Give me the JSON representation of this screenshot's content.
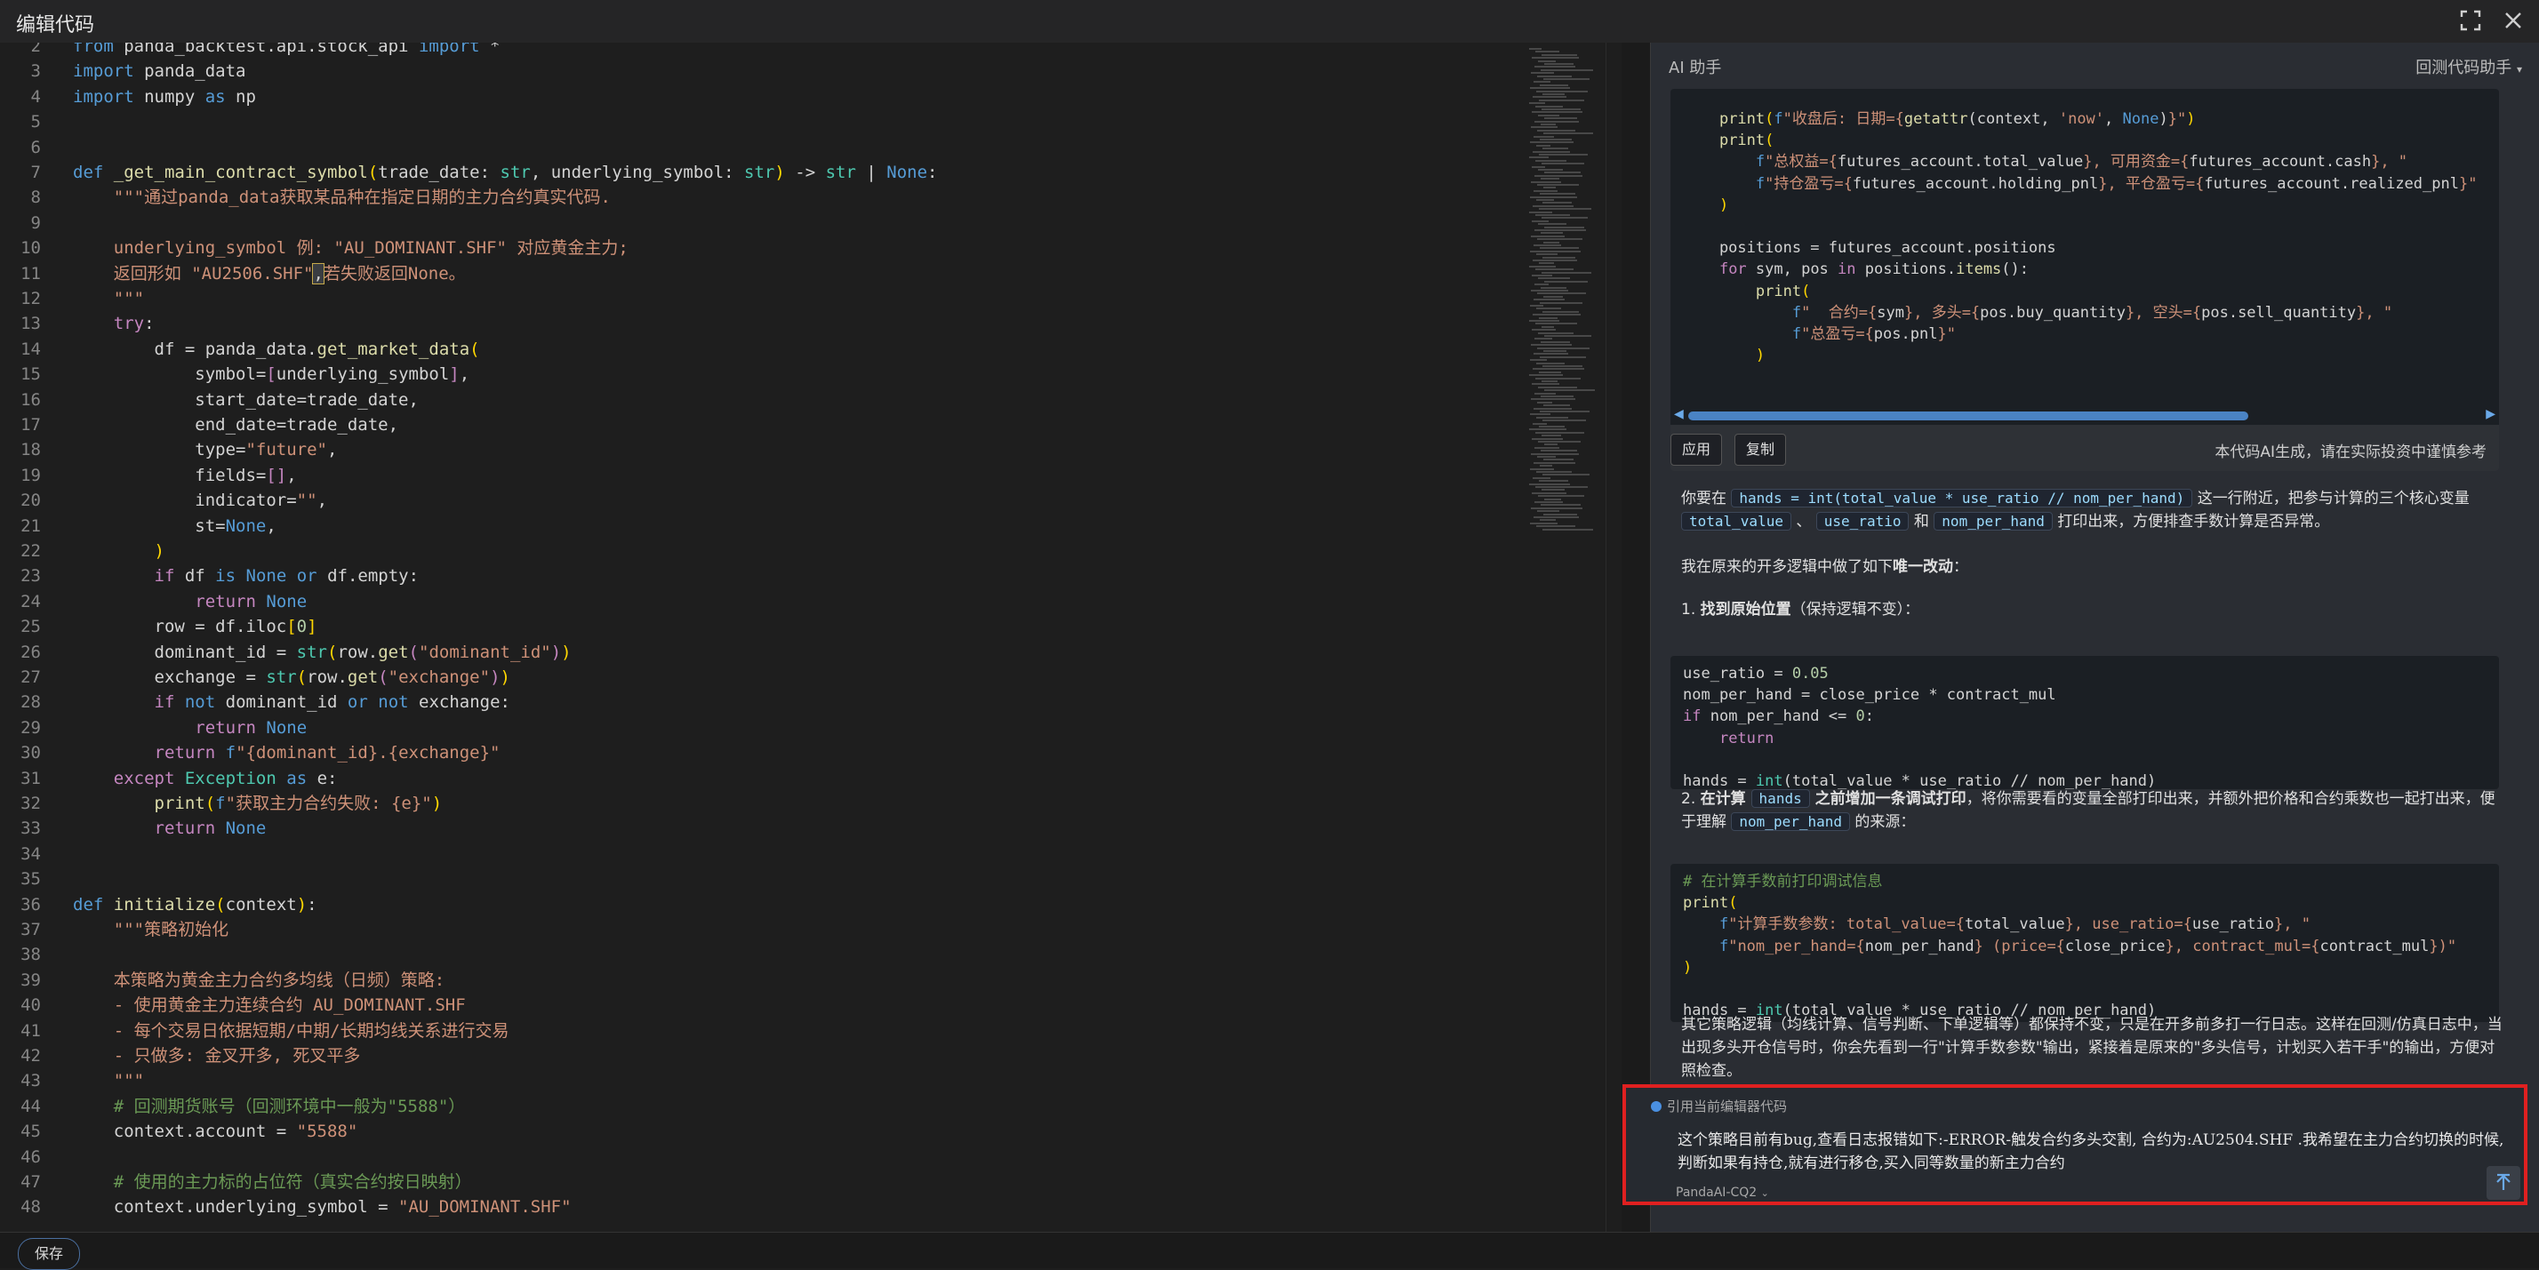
{
  "window": {
    "title": "编辑代码",
    "bottom_button": "保存"
  },
  "editor": {
    "lines": [
      {
        "n": "2",
        "t": [
          [
            "kw",
            "from"
          ],
          [
            "id",
            " panda_backtest.api.stock_api "
          ],
          [
            "kw",
            "import"
          ],
          [
            "id",
            " *"
          ]
        ]
      },
      {
        "n": "3",
        "t": [
          [
            "kw",
            "import"
          ],
          [
            "id",
            " panda_data"
          ]
        ]
      },
      {
        "n": "4",
        "t": [
          [
            "kw",
            "import"
          ],
          [
            "id",
            " numpy "
          ],
          [
            "kw",
            "as"
          ],
          [
            "id",
            " np"
          ]
        ]
      },
      {
        "n": "5",
        "t": []
      },
      {
        "n": "6",
        "t": []
      },
      {
        "n": "7",
        "t": [
          [
            "kw",
            "def"
          ],
          [
            "id",
            " "
          ],
          [
            "fn",
            "_get_main_contract_symbol"
          ],
          [
            "pa",
            "("
          ],
          [
            "id",
            "trade_date: "
          ],
          [
            "bu",
            "str"
          ],
          [
            "id",
            ", underlying_symbol: "
          ],
          [
            "bu",
            "str"
          ],
          [
            "pa",
            ")"
          ],
          [
            "id",
            " -> "
          ],
          [
            "bu",
            "str"
          ],
          [
            "id",
            " | "
          ],
          [
            "kw",
            "None"
          ],
          [
            "id",
            ":"
          ]
        ]
      },
      {
        "n": "8",
        "t": [
          [
            "str",
            "    \"\"\"通过panda_data获取某品种在指定日期的主力合约真实代码."
          ]
        ]
      },
      {
        "n": "9",
        "t": []
      },
      {
        "n": "10",
        "t": [
          [
            "str",
            "    underlying_symbol 例: \"AU_DOMINANT.SHF\" 对应黄金主力;"
          ]
        ]
      },
      {
        "n": "11",
        "t": [
          [
            "str",
            "    返回形如 \"AU2506.SHF\""
          ],
          [
            "hl",
            ","
          ],
          [
            "str",
            "若失败返回None。"
          ]
        ]
      },
      {
        "n": "12",
        "t": [
          [
            "str",
            "    \"\"\""
          ]
        ]
      },
      {
        "n": "13",
        "t": [
          [
            "id",
            "    "
          ],
          [
            "ctl",
            "try"
          ],
          [
            "id",
            ":"
          ]
        ]
      },
      {
        "n": "14",
        "t": [
          [
            "id",
            "        df = panda_data."
          ],
          [
            "fn",
            "get_market_data"
          ],
          [
            "pa",
            "("
          ]
        ]
      },
      {
        "n": "15",
        "t": [
          [
            "id",
            "            symbol="
          ],
          [
            "ctl",
            "["
          ],
          [
            "id",
            "underlying_symbol"
          ],
          [
            "ctl",
            "]"
          ],
          [
            "id",
            ","
          ]
        ]
      },
      {
        "n": "16",
        "t": [
          [
            "id",
            "            start_date=trade_date,"
          ]
        ]
      },
      {
        "n": "17",
        "t": [
          [
            "id",
            "            end_date=trade_date,"
          ]
        ]
      },
      {
        "n": "18",
        "t": [
          [
            "id",
            "            type="
          ],
          [
            "str",
            "\"future\""
          ],
          [
            "id",
            ","
          ]
        ]
      },
      {
        "n": "19",
        "t": [
          [
            "id",
            "            fields="
          ],
          [
            "ctl",
            "[]"
          ],
          [
            "id",
            ","
          ]
        ]
      },
      {
        "n": "20",
        "t": [
          [
            "id",
            "            indicator="
          ],
          [
            "str",
            "\"\""
          ],
          [
            "id",
            ","
          ]
        ]
      },
      {
        "n": "21",
        "t": [
          [
            "id",
            "            st="
          ],
          [
            "kw",
            "None"
          ],
          [
            "id",
            ","
          ]
        ]
      },
      {
        "n": "22",
        "t": [
          [
            "pa",
            "        )"
          ]
        ]
      },
      {
        "n": "23",
        "t": [
          [
            "id",
            "        "
          ],
          [
            "ctl",
            "if"
          ],
          [
            "id",
            " df "
          ],
          [
            "kw",
            "is"
          ],
          [
            "id",
            " "
          ],
          [
            "kw",
            "None"
          ],
          [
            "id",
            " "
          ],
          [
            "kw",
            "or"
          ],
          [
            "id",
            " df.empty:"
          ]
        ]
      },
      {
        "n": "24",
        "t": [
          [
            "id",
            "            "
          ],
          [
            "ctl",
            "return"
          ],
          [
            "id",
            " "
          ],
          [
            "kw",
            "None"
          ]
        ]
      },
      {
        "n": "25",
        "t": [
          [
            "id",
            "        row = df.iloc"
          ],
          [
            "pa",
            "["
          ],
          [
            "num",
            "0"
          ],
          [
            "pa",
            "]"
          ]
        ]
      },
      {
        "n": "26",
        "t": [
          [
            "id",
            "        dominant_id = "
          ],
          [
            "bu",
            "str"
          ],
          [
            "pa",
            "("
          ],
          [
            "id",
            "row."
          ],
          [
            "fn",
            "get"
          ],
          [
            "ctl",
            "("
          ],
          [
            "str",
            "\"dominant_id\""
          ],
          [
            "ctl",
            ")"
          ],
          [
            "pa",
            ")"
          ]
        ]
      },
      {
        "n": "27",
        "t": [
          [
            "id",
            "        exchange = "
          ],
          [
            "bu",
            "str"
          ],
          [
            "pa",
            "("
          ],
          [
            "id",
            "row."
          ],
          [
            "fn",
            "get"
          ],
          [
            "ctl",
            "("
          ],
          [
            "str",
            "\"exchange\""
          ],
          [
            "ctl",
            ")"
          ],
          [
            "pa",
            ")"
          ]
        ]
      },
      {
        "n": "28",
        "t": [
          [
            "id",
            "        "
          ],
          [
            "ctl",
            "if"
          ],
          [
            "id",
            " "
          ],
          [
            "kw",
            "not"
          ],
          [
            "id",
            " dominant_id "
          ],
          [
            "kw",
            "or"
          ],
          [
            "id",
            " "
          ],
          [
            "kw",
            "not"
          ],
          [
            "id",
            " exchange:"
          ]
        ]
      },
      {
        "n": "29",
        "t": [
          [
            "id",
            "            "
          ],
          [
            "ctl",
            "return"
          ],
          [
            "id",
            " "
          ],
          [
            "kw",
            "None"
          ]
        ]
      },
      {
        "n": "30",
        "t": [
          [
            "id",
            "        "
          ],
          [
            "ctl",
            "return"
          ],
          [
            "id",
            " "
          ],
          [
            "kw",
            "f"
          ],
          [
            "str",
            "\"{dominant_id}.{exchange}\""
          ]
        ]
      },
      {
        "n": "31",
        "t": [
          [
            "id",
            "    "
          ],
          [
            "ctl",
            "except"
          ],
          [
            "id",
            " "
          ],
          [
            "bu",
            "Exception"
          ],
          [
            "id",
            " "
          ],
          [
            "kw",
            "as"
          ],
          [
            "id",
            " e:"
          ]
        ]
      },
      {
        "n": "32",
        "t": [
          [
            "id",
            "        "
          ],
          [
            "fn",
            "print"
          ],
          [
            "pa",
            "("
          ],
          [
            "kw",
            "f"
          ],
          [
            "str",
            "\"获取主力合约失败: {e}\""
          ],
          [
            "pa",
            ")"
          ]
        ]
      },
      {
        "n": "33",
        "t": [
          [
            "id",
            "        "
          ],
          [
            "ctl",
            "return"
          ],
          [
            "id",
            " "
          ],
          [
            "kw",
            "None"
          ]
        ]
      },
      {
        "n": "34",
        "t": []
      },
      {
        "n": "35",
        "t": []
      },
      {
        "n": "36",
        "t": [
          [
            "kw",
            "def"
          ],
          [
            "id",
            " "
          ],
          [
            "fn",
            "initialize"
          ],
          [
            "pa",
            "("
          ],
          [
            "id",
            "context"
          ],
          [
            "pa",
            ")"
          ],
          [
            "id",
            ":"
          ]
        ]
      },
      {
        "n": "37",
        "t": [
          [
            "str",
            "    \"\"\"策略初始化"
          ]
        ]
      },
      {
        "n": "38",
        "t": []
      },
      {
        "n": "39",
        "t": [
          [
            "str",
            "    本策略为黄金主力合约多均线（日频）策略:"
          ]
        ]
      },
      {
        "n": "40",
        "t": [
          [
            "str",
            "    - 使用黄金主力连续合约 AU_DOMINANT.SHF"
          ]
        ]
      },
      {
        "n": "41",
        "t": [
          [
            "str",
            "    - 每个交易日依据短期/中期/长期均线关系进行交易"
          ]
        ]
      },
      {
        "n": "42",
        "t": [
          [
            "str",
            "    - 只做多: 金叉开多, 死叉平多"
          ]
        ]
      },
      {
        "n": "43",
        "t": [
          [
            "str",
            "    \"\"\""
          ]
        ]
      },
      {
        "n": "44",
        "t": [
          [
            "cm",
            "    # 回测期货账号（回测环境中一般为\"5588\"）"
          ]
        ]
      },
      {
        "n": "45",
        "t": [
          [
            "id",
            "    context.account = "
          ],
          [
            "str",
            "\"5588\""
          ]
        ]
      },
      {
        "n": "46",
        "t": []
      },
      {
        "n": "47",
        "t": [
          [
            "cm",
            "    # 使用的主力标的占位符（真实合约按日映射）"
          ]
        ]
      },
      {
        "n": "48",
        "t": [
          [
            "id",
            "    context.underlying_symbol = "
          ],
          [
            "str",
            "\"AU_DOMINANT.SHF\""
          ]
        ]
      }
    ]
  },
  "assistant": {
    "title": "AI 助手",
    "mode": "回测代码助手",
    "code1": [
      [
        [
          "id",
          "    "
        ],
        [
          "fn",
          "print"
        ],
        [
          "pa",
          "("
        ],
        [
          "kw",
          "f"
        ],
        [
          "str",
          "\"收盘后: 日期={"
        ],
        [
          "fn",
          "getattr"
        ],
        [
          "id",
          "(context, "
        ],
        [
          "str",
          "'now'"
        ],
        [
          "id",
          ", "
        ],
        [
          "kw",
          "None"
        ],
        [
          "id",
          ")"
        ],
        [
          "str",
          "}\""
        ],
        [
          "pa",
          ")"
        ]
      ],
      [
        [
          "id",
          "    "
        ],
        [
          "fn",
          "print"
        ],
        [
          "pa",
          "("
        ]
      ],
      [
        [
          "id",
          "        "
        ],
        [
          "kw",
          "f"
        ],
        [
          "str",
          "\"总权益={"
        ],
        [
          "id",
          "futures_account.total_value"
        ],
        [
          "str",
          "}, 可用资金={"
        ],
        [
          "id",
          "futures_account.cash"
        ],
        [
          "str",
          "}, \""
        ]
      ],
      [
        [
          "id",
          "        "
        ],
        [
          "kw",
          "f"
        ],
        [
          "str",
          "\"持仓盈亏={"
        ],
        [
          "id",
          "futures_account.holding_pnl"
        ],
        [
          "str",
          "}, 平仓盈亏={"
        ],
        [
          "id",
          "futures_account.realized_pnl"
        ],
        [
          "str",
          "}\""
        ]
      ],
      [
        [
          "pa",
          "    )"
        ]
      ],
      [],
      [
        [
          "id",
          "    positions = futures_account.positions"
        ]
      ],
      [
        [
          "id",
          "    "
        ],
        [
          "ctl",
          "for"
        ],
        [
          "id",
          " sym, pos "
        ],
        [
          "ctl",
          "in"
        ],
        [
          "id",
          " positions."
        ],
        [
          "fn",
          "items"
        ],
        [
          "id",
          "():"
        ]
      ],
      [
        [
          "id",
          "        "
        ],
        [
          "fn",
          "print"
        ],
        [
          "pa",
          "("
        ]
      ],
      [
        [
          "id",
          "            "
        ],
        [
          "kw",
          "f"
        ],
        [
          "str",
          "\"  合约={"
        ],
        [
          "id",
          "sym"
        ],
        [
          "str",
          "}, 多头={"
        ],
        [
          "id",
          "pos.buy_quantity"
        ],
        [
          "str",
          "}, 空头={"
        ],
        [
          "id",
          "pos.sell_quantity"
        ],
        [
          "str",
          "}, \""
        ]
      ],
      [
        [
          "id",
          "            "
        ],
        [
          "kw",
          "f"
        ],
        [
          "str",
          "\"总盈亏={"
        ],
        [
          "id",
          "pos.pnl"
        ],
        [
          "str",
          "}\""
        ]
      ],
      [
        [
          "pa",
          "        )"
        ]
      ]
    ],
    "btn_apply": "应用",
    "btn_copy": "复制",
    "disclaimer": "本代码AI生成，请在实际投资中谨慎参考",
    "p1a": "你要在 ",
    "p1_code": "hands = int(total_value * use_ratio // nom_per_hand)",
    "p1b": " 这一行附近，把参与计算的三个核心变量",
    "p1_v1": "total_value",
    "p1_sep": " 、",
    "p1_v2": "use_ratio",
    "p1_and": " 和 ",
    "p1_v3": "nom_per_hand",
    "p1c": " 打印出来，方便排查手数计算是否异常。",
    "p2a": "我在原来的开多逻辑中做了如下",
    "p2b": "唯一改动",
    "p2c": "：",
    "s1num": "1. ",
    "s1a": "找到原始位置",
    "s1b": "（保持逻辑不变）：",
    "code2": [
      [
        [
          "id",
          "use_ratio = "
        ],
        [
          "num",
          "0.05"
        ]
      ],
      [
        [
          "id",
          "nom_per_hand = close_price * contract_mul"
        ]
      ],
      [
        [
          "ctl",
          "if"
        ],
        [
          "id",
          " nom_per_hand <= "
        ],
        [
          "num",
          "0"
        ],
        [
          "id",
          ":"
        ]
      ],
      [
        [
          "id",
          "    "
        ],
        [
          "ctl",
          "return"
        ]
      ],
      [],
      [
        [
          "id",
          "hands = "
        ],
        [
          "bu",
          "int"
        ],
        [
          "id",
          "(total_value * use_ratio // nom_per_hand)"
        ]
      ]
    ],
    "s2num": "2. ",
    "s2a": "在计算 ",
    "s2code": "hands",
    "s2b": " 之前增加一条调试打印",
    "s2c": "，将你需要看的变量全部打印出来，并额外把价格和合约乘数也一起打出来，便于理解 ",
    "s2code2": "nom_per_hand",
    "s2d": " 的来源：",
    "code3": [
      [
        [
          "cm",
          "# 在计算手数前打印调试信息"
        ]
      ],
      [
        [
          "fn",
          "print"
        ],
        [
          "pa",
          "("
        ]
      ],
      [
        [
          "id",
          "    "
        ],
        [
          "kw",
          "f"
        ],
        [
          "str",
          "\"计算手数参数: total_value={"
        ],
        [
          "id",
          "total_value"
        ],
        [
          "str",
          "}, use_ratio={"
        ],
        [
          "id",
          "use_ratio"
        ],
        [
          "str",
          "}, \""
        ]
      ],
      [
        [
          "id",
          "    "
        ],
        [
          "kw",
          "f"
        ],
        [
          "str",
          "\"nom_per_hand={"
        ],
        [
          "id",
          "nom_per_hand"
        ],
        [
          "str",
          "} (price={"
        ],
        [
          "id",
          "close_price"
        ],
        [
          "str",
          "}, contract_mul={"
        ],
        [
          "id",
          "contract_mul"
        ],
        [
          "str",
          "})\""
        ]
      ],
      [
        [
          "pa",
          ")"
        ]
      ],
      [],
      [
        [
          "id",
          "hands = "
        ],
        [
          "bu",
          "int"
        ],
        [
          "id",
          "(total_value * use_ratio // nom_per_hand)"
        ]
      ]
    ],
    "p3": "其它策略逻辑（均线计算、信号判断、下单逻辑等）都保持不变，只是在开多前多打一行日志。这样在回测/仿真日志中，当出现多头开仓信号时，你会先看到一行\"计算手数参数\"输出，紧接着是原来的\"多头信号，计划买入若干手\"的输出，方便对照检查。",
    "ref_label": "引用当前编辑器代码",
    "input_text": "这个策略目前有bug,查看日志报错如下:-ERROR-触发合约多头交割, 合约为:AU2504.SHF .我希望在主力合约切换的时候,判断如果有持仓,就有进行移仓,买入同等数量的新主力合约",
    "model": "PandaAI-CQ2"
  }
}
